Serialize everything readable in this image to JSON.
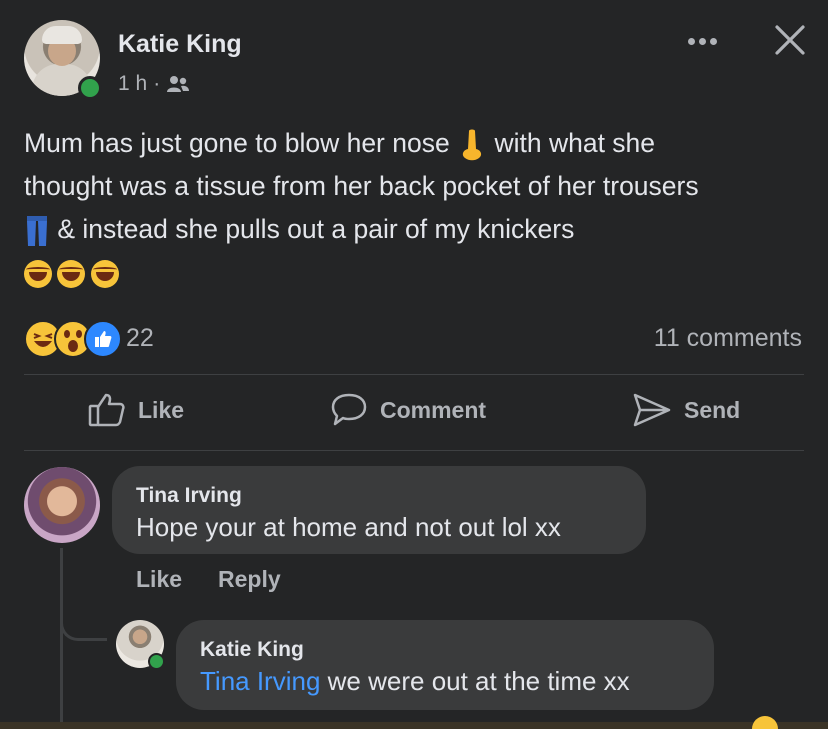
{
  "post": {
    "author": "Katie King",
    "time": "1 h",
    "separator": "·",
    "privacy_icon": "friends-icon",
    "text_line1a": "Mum has just gone to blow her nose",
    "text_line1b": "with what she",
    "text_line2": "thought was a tissue from her back pocket of her trousers",
    "text_line3": "& instead she pulls out a pair of my knickers",
    "reactions": [
      "haha",
      "wow",
      "like"
    ],
    "reaction_count": "22",
    "comment_count": "11 comments"
  },
  "actions": {
    "like": "Like",
    "comment": "Comment",
    "send": "Send"
  },
  "comments": [
    {
      "name": "Tina Irving",
      "text": "Hope your at home and not out lol xx",
      "like": "Like",
      "reply": "Reply"
    }
  ],
  "reply": {
    "name": "Katie King",
    "mention": "Tina Irving",
    "text": "we were out at the time xx"
  },
  "colors": {
    "background": "#242526",
    "bubble": "#3a3b3c",
    "link": "#4599ff",
    "online": "#31a24c"
  }
}
